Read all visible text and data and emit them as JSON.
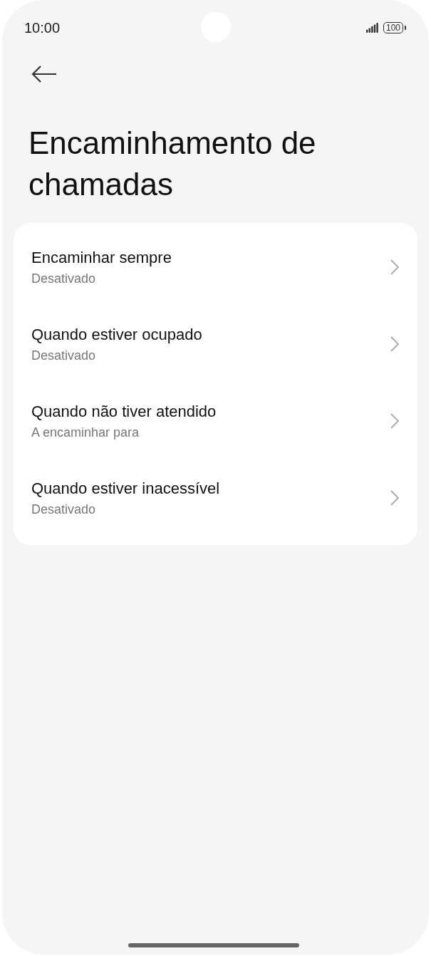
{
  "status_bar": {
    "time": "10:00",
    "battery": "100"
  },
  "title": "Encaminhamento de chamadas",
  "items": [
    {
      "title": "Encaminhar sempre",
      "subtitle": "Desativado"
    },
    {
      "title": "Quando estiver ocupado",
      "subtitle": "Desativado"
    },
    {
      "title": "Quando não tiver atendido",
      "subtitle": "A encaminhar para"
    },
    {
      "title": "Quando estiver inacessível",
      "subtitle": "Desativado"
    }
  ]
}
